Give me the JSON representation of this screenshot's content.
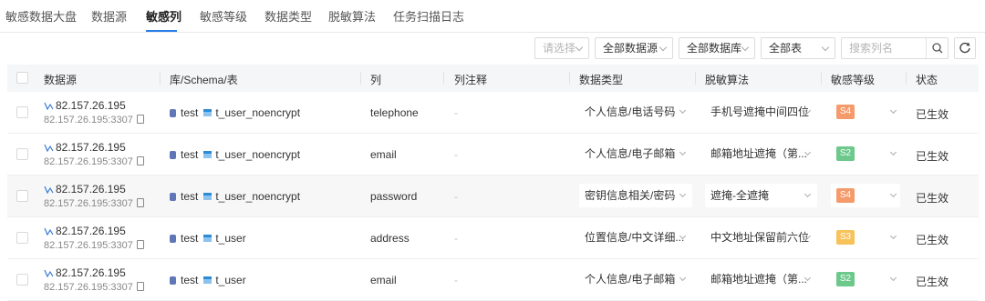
{
  "tabs": [
    {
      "label": "敏感数据大盘"
    },
    {
      "label": "数据源"
    },
    {
      "label": "敏感列"
    },
    {
      "label": "敏感等级"
    },
    {
      "label": "数据类型"
    },
    {
      "label": "脱敏算法"
    },
    {
      "label": "任务扫描日志"
    }
  ],
  "active_tab_index": 2,
  "filters": {
    "select_placeholder": "请选择",
    "datasource": "全部数据源",
    "database": "全部数据库",
    "table": "全部表",
    "search_placeholder": "搜索列名"
  },
  "columns": {
    "datasource": "数据源",
    "schema": "库/Schema/表",
    "column": "列",
    "comment": "列注释",
    "data_type": "数据类型",
    "algorithm": "脱敏算法",
    "level": "敏感等级",
    "status": "状态"
  },
  "level_colors": {
    "S4": "#f59a6b",
    "S2": "#6cc88b",
    "S3": "#f7c25a"
  },
  "rows": [
    {
      "host": "82.157.26.195",
      "host_port": "82.157.26.195:3307",
      "db": "test",
      "table": "t_user_noencrypt",
      "column": "telephone",
      "comment": "-",
      "data_type": "个人信息/电话号码",
      "algorithm": "手机号遮掩中间四位",
      "level": "S4",
      "status": "已生效"
    },
    {
      "host": "82.157.26.195",
      "host_port": "82.157.26.195:3307",
      "db": "test",
      "table": "t_user_noencrypt",
      "column": "email",
      "comment": "-",
      "data_type": "个人信息/电子邮箱",
      "algorithm": "邮箱地址遮掩（第...",
      "level": "S2",
      "status": "已生效"
    },
    {
      "host": "82.157.26.195",
      "host_port": "82.157.26.195:3307",
      "db": "test",
      "table": "t_user_noencrypt",
      "column": "password",
      "comment": "-",
      "data_type": "密钥信息相关/密码",
      "algorithm": "遮掩-全遮掩",
      "level": "S4",
      "status": "已生效"
    },
    {
      "host": "82.157.26.195",
      "host_port": "82.157.26.195:3307",
      "db": "test",
      "table": "t_user",
      "column": "address",
      "comment": "-",
      "data_type": "位置信息/中文详细...",
      "algorithm": "中文地址保留前六位",
      "level": "S3",
      "status": "已生效"
    },
    {
      "host": "82.157.26.195",
      "host_port": "82.157.26.195:3307",
      "db": "test",
      "table": "t_user",
      "column": "email",
      "comment": "-",
      "data_type": "个人信息/电子邮箱",
      "algorithm": "邮箱地址遮掩（第...",
      "level": "S2",
      "status": "已生效"
    }
  ]
}
